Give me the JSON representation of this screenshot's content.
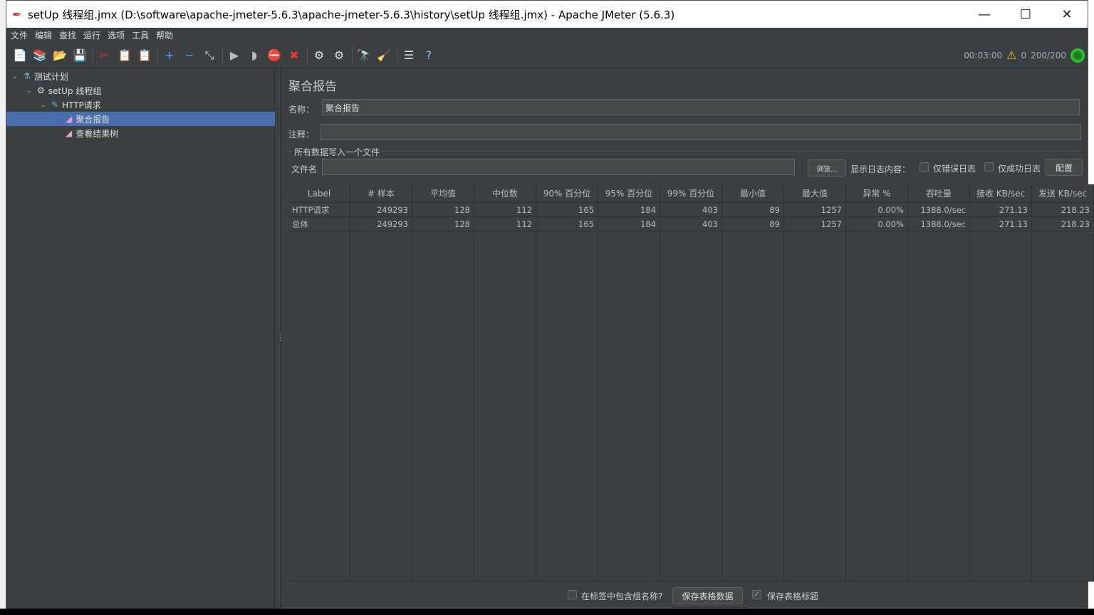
{
  "window": {
    "title": "setUp 线程组.jmx (D:\\software\\apache-jmeter-5.6.3\\apache-jmeter-5.6.3\\history\\setUp 线程组.jmx) - Apache JMeter (5.6.3)",
    "minimize": "—",
    "maximize": "☐",
    "close": "✕"
  },
  "menu": [
    "文件",
    "编辑",
    "查找",
    "运行",
    "选项",
    "工具",
    "帮助"
  ],
  "toolbar": [
    {
      "name": "new-icon",
      "glyph": "📄"
    },
    {
      "name": "templates-icon",
      "glyph": "📚"
    },
    {
      "name": "open-icon",
      "glyph": "📂"
    },
    {
      "name": "save-icon",
      "glyph": "💾"
    },
    {
      "sep": true
    },
    {
      "name": "cut-icon",
      "glyph": "✂"
    },
    {
      "name": "copy-icon",
      "glyph": "📋"
    },
    {
      "name": "paste-icon",
      "glyph": "📋"
    },
    {
      "sep": true
    },
    {
      "name": "expand-icon",
      "glyph": "+"
    },
    {
      "name": "collapse-icon",
      "glyph": "−"
    },
    {
      "name": "toggle-icon",
      "glyph": "⤡"
    },
    {
      "sep": true
    },
    {
      "name": "start-icon",
      "glyph": "▶"
    },
    {
      "name": "start-no-pauses-icon",
      "glyph": "◗"
    },
    {
      "name": "stop-icon",
      "glyph": "⛔"
    },
    {
      "name": "shutdown-icon",
      "glyph": "✖"
    },
    {
      "sep": true
    },
    {
      "name": "clear-icon",
      "glyph": "⚙"
    },
    {
      "name": "clear-all-icon",
      "glyph": "⚙"
    },
    {
      "sep": true
    },
    {
      "name": "search-icon",
      "glyph": "🔭"
    },
    {
      "name": "reset-search-icon",
      "glyph": "🧹"
    },
    {
      "sep": true
    },
    {
      "name": "function-helper-icon",
      "glyph": "☰"
    },
    {
      "name": "help-icon",
      "glyph": "?"
    }
  ],
  "status": {
    "elapsed": "00:03:00",
    "warnings": "0",
    "threads": "200/200",
    "warning_color": "#f0c419",
    "running_color": "#33cc33"
  },
  "tree": [
    {
      "label": "测试计划",
      "icon": "flask-icon",
      "glyph": "⚗",
      "depth": 0,
      "expanded": true
    },
    {
      "label": "setUp 线程组",
      "icon": "gear-icon",
      "glyph": "⚙",
      "depth": 1,
      "expanded": true
    },
    {
      "label": "HTTP请求",
      "icon": "pipette-icon",
      "glyph": "✎",
      "depth": 2,
      "expanded": true
    },
    {
      "label": "聚合报告",
      "icon": "report-icon",
      "glyph": "◢",
      "depth": 3,
      "selected": true
    },
    {
      "label": "查看结果树",
      "icon": "report-icon",
      "glyph": "◢",
      "depth": 3
    }
  ],
  "panel": {
    "heading": "聚合报告",
    "name_label": "名称：",
    "name_value": "聚合报告",
    "comment_label": "注释：",
    "comment_value": "",
    "file_section": "所有数据写入一个文件",
    "filename_label": "文件名",
    "filename_value": "",
    "browse": "浏览...",
    "log_label": "显示日志内容：",
    "errors_only": "仅错误日志",
    "success_only": "仅成功日志",
    "configure": "配置"
  },
  "table": {
    "columns": [
      "Label",
      "# 样本",
      "平均值",
      "中位数",
      "90% 百分位",
      "95% 百分位",
      "99% 百分位",
      "最小值",
      "最大值",
      "异常 %",
      "吞吐量",
      "接收 KB/sec",
      "发送 KB/sec"
    ],
    "rows": [
      [
        "HTTP请求",
        "249293",
        "128",
        "112",
        "165",
        "184",
        "403",
        "89",
        "1257",
        "0.00%",
        "1388.0/sec",
        "271.13",
        "218.23"
      ],
      [
        "总体",
        "249293",
        "128",
        "112",
        "165",
        "184",
        "403",
        "89",
        "1257",
        "0.00%",
        "1388.0/sec",
        "271.13",
        "218.23"
      ]
    ]
  },
  "footer": {
    "include_group": "在标签中包含组名称?",
    "include_group_checked": false,
    "save_table": "保存表格数据",
    "save_header": "保存表格标题",
    "save_header_checked": true
  }
}
